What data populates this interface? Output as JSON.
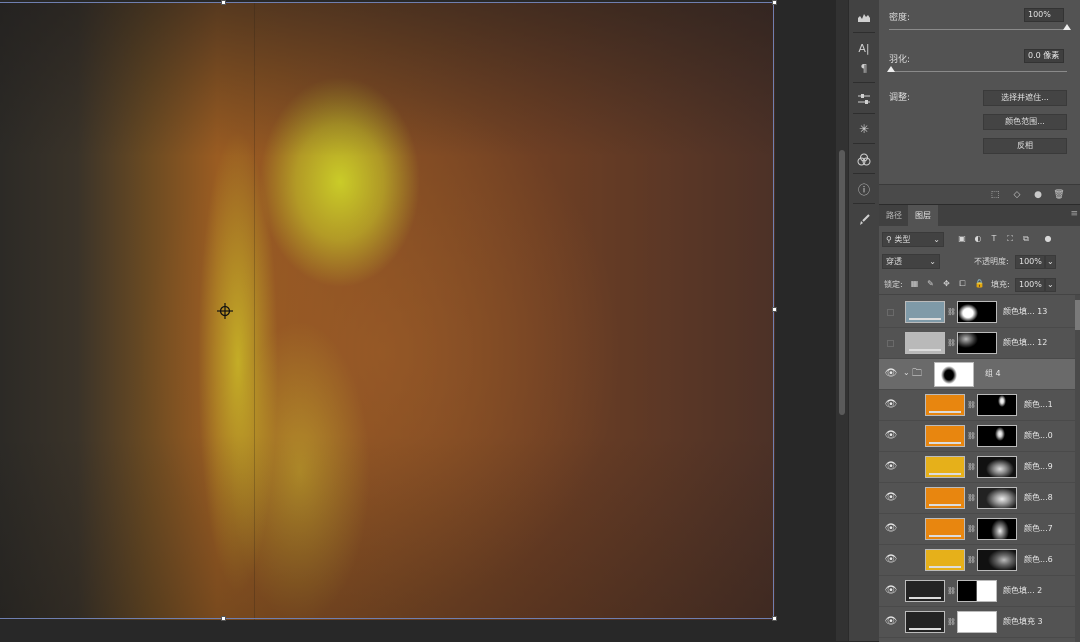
{
  "properties": {
    "density_label": "密度:",
    "density_value": "100%",
    "density_level": 1.0,
    "feather_label": "羽化:",
    "feather_value": "0.0 像素",
    "feather_level": 0.0,
    "adjust_label": "调整:",
    "buttons": [
      "选择并遮住...",
      "颜色范围...",
      "反相"
    ]
  },
  "layers_panel": {
    "tabs": [
      "路径",
      "图层"
    ],
    "active_tab": "图层",
    "filter_label": "类型",
    "blend_mode": "穿透",
    "opacity_label": "不透明度:",
    "opacity_value": "100%",
    "lock_label": "锁定:",
    "fill_label": "填充:",
    "fill_value": "100%",
    "layers": [
      {
        "name": "颜色填... 13",
        "visible": false,
        "swatch": "#7f9aa8",
        "indent": false
      },
      {
        "name": "颜色填... 12",
        "visible": false,
        "swatch": "#b9b9b9",
        "indent": false
      },
      {
        "name": "组 4",
        "visible": true,
        "group": true,
        "indent": false
      },
      {
        "name": "颜色...1",
        "visible": true,
        "swatch": "#e8860f",
        "indent": true
      },
      {
        "name": "颜色...0",
        "visible": true,
        "swatch": "#e8860f",
        "indent": true
      },
      {
        "name": "颜色...9",
        "visible": true,
        "swatch": "#e6b01a",
        "indent": true
      },
      {
        "name": "颜色...8",
        "visible": true,
        "swatch": "#e8860f",
        "indent": true
      },
      {
        "name": "颜色...7",
        "visible": true,
        "swatch": "#e8860f",
        "indent": true
      },
      {
        "name": "颜色...6",
        "visible": true,
        "swatch": "#e6b01a",
        "indent": true
      },
      {
        "name": "颜色填... 2",
        "visible": true,
        "swatch": "#232323",
        "indent": false
      },
      {
        "name": "颜色填充 3",
        "visible": true,
        "swatch": "#232323",
        "indent": false
      }
    ]
  }
}
